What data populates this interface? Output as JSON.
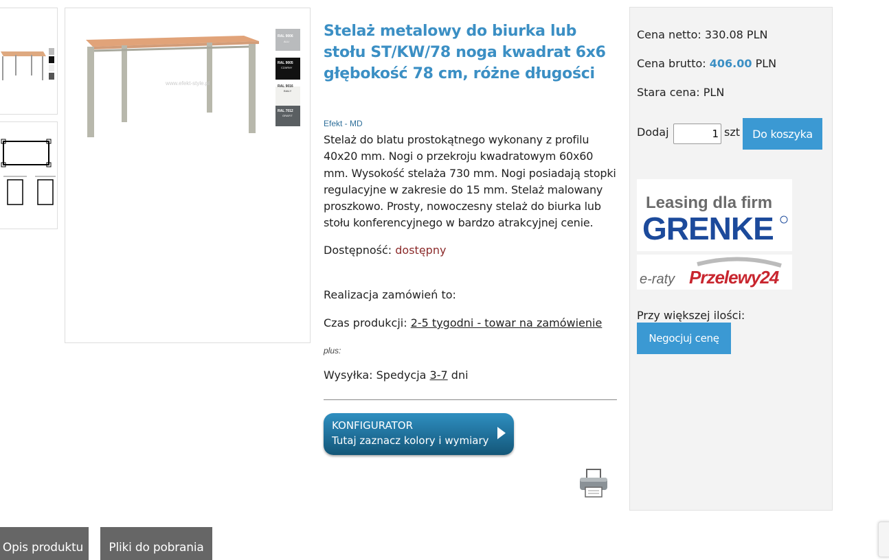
{
  "product": {
    "title": "Stelaż metalowy do biurka lub stołu ST/KW/78 noga kwadrat 6x6 głębokość 78 cm, różne długości",
    "brand": "Efekt - MD",
    "description": "Stelaż do blatu prostokątnego wykonany z profilu 40x20 mm. Nogi o przekroju kwadratowym 60x60 mm. Wysokość stelaża 730 mm. Nogi posiadają stopki regulacyjne w zakresie do 15 mm. Stelaż malowany proszkowo. Prosty, nowoczesny stelaż do biurka lub stołu konferencyjnego w bardzo atrakcyjnej cenie.",
    "availability_label": "Dostępność:",
    "availability_value": "dostępny",
    "realization_label": "Realizacja zamówień to:",
    "production_label": "Czas produkcji:",
    "production_value": "2-5 tygodni - towar na zamówienie",
    "plus": "plus:",
    "shipping_label": "Wysyłka: Spedycja",
    "shipping_days": "3-7",
    "shipping_unit": "dni",
    "configurator": {
      "line1": "KONFIGURATOR",
      "line2": "Tutaj zaznacz kolory i wymiary"
    }
  },
  "image": {
    "watermark": "www.efekt-style.pl",
    "colors": [
      {
        "code": "RAL 9006",
        "name": "ALU",
        "hex": "#b9bbbd"
      },
      {
        "code": "RAL 9005",
        "name": "CZARNY",
        "hex": "#111111"
      },
      {
        "code": "RAL 9016",
        "name": "BIAŁY",
        "hex": "#f1f1ee"
      },
      {
        "code": "RAL 7012",
        "name": "GRAFIT",
        "hex": "#5a5f62"
      }
    ]
  },
  "pricing": {
    "net_label": "Cena netto:",
    "net_value": "330.08 PLN",
    "gross_label": "Cena brutto:",
    "gross_value": "406.00",
    "gross_currency": "PLN",
    "old_label": "Stara cena:",
    "old_value": " PLN",
    "add_label": "Dodaj",
    "quantity": "1",
    "unit": "szt",
    "cart_button": "Do koszyka",
    "leasing_line": "Leasing dla firm",
    "leasing_brand": "GRENKE",
    "installments_prefix": "e-raty",
    "installments_brand": "Przelewy24",
    "more_label": "Przy większej ilości:",
    "negotiate_button": "Negocjuj cenę"
  },
  "tabs": [
    "Opis produktu",
    "Pliki do pobrania"
  ],
  "colors": {
    "accent": "#3b8fc4",
    "button": "#3b99d3",
    "availability": "#8b2a2a",
    "tab": "#666666"
  }
}
